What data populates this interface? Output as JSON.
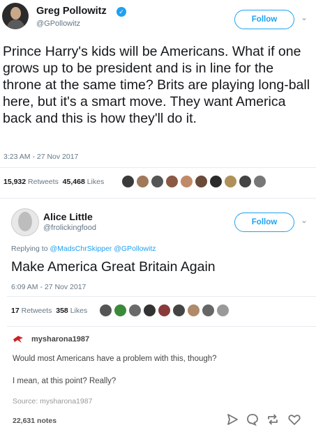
{
  "tweet1": {
    "name": "Greg Pollowitz",
    "handle": "@GPollowitz",
    "follow_label": "Follow",
    "text": "Prince Harry's kids will be Americans. What if one grows up to be president and is in line for the throne at the same time? Brits are playing long-ball here, but it's a smart move. They want America back and this is how they'll do it.",
    "timestamp": "3:23 AM - 27 Nov 2017",
    "retweets_count": "15,932",
    "retweets_label": "Retweets",
    "likes_count": "45,468",
    "likes_label": "Likes",
    "liker_colors": [
      "#3a3a3a",
      "#a0785a",
      "#555555",
      "#8a5a44",
      "#c08a6a",
      "#6a4a3a",
      "#2a2a2a",
      "#b0905a",
      "#444444",
      "#777777"
    ]
  },
  "tweet2": {
    "name": "Alice Little",
    "handle": "@frolickingfood",
    "follow_label": "Follow",
    "reply_prefix": "Replying to",
    "reply_to_1": "@MadsChrSkipper",
    "reply_to_2": "@GPollowitz",
    "text": "Make America Great Britain Again",
    "timestamp": "6:09 AM - 27 Nov 2017",
    "retweets_count": "17",
    "retweets_label": "Retweets",
    "likes_count": "358",
    "likes_label": "Likes",
    "liker_colors": [
      "#555555",
      "#3a8a3a",
      "#6a6a6a",
      "#333333",
      "#8a3a3a",
      "#444444",
      "#b08a6a",
      "#666666",
      "#999999"
    ]
  },
  "tumblr_post": {
    "username": "mysharona1987",
    "line1": "Would most Americans have a problem with this, though?",
    "line2": "I mean, at this point? Really?",
    "source_label": "Source:",
    "source_name": "mysharona1987",
    "notes": "22,631 notes",
    "accent_color": "#cc2222"
  },
  "icons": {
    "verified": "verified-badge-icon",
    "chevron": "chevron-down-icon",
    "share": "share-arrow-icon",
    "reply": "reply-bubble-icon",
    "reblog": "reblog-icon",
    "like": "heart-icon"
  }
}
